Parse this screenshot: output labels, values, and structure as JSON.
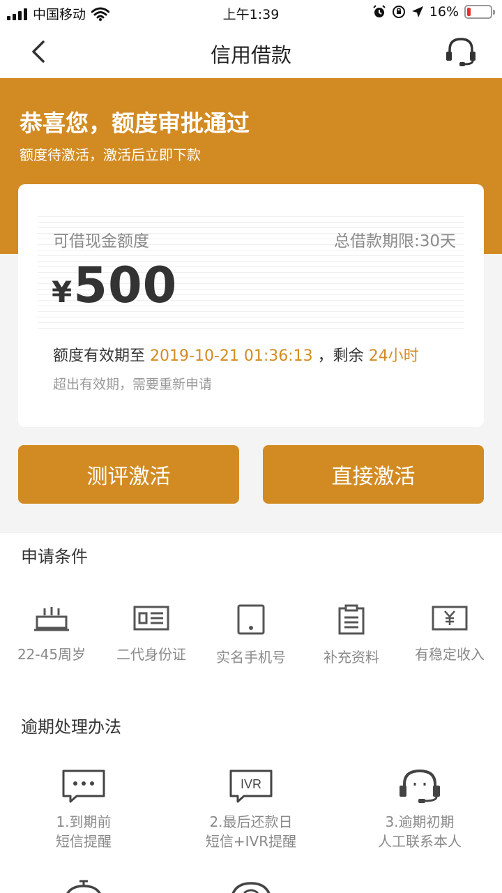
{
  "status_bar": {
    "carrier": "中国移动",
    "time": "上午1:39",
    "battery": "16%",
    "battery_level": 0.16
  },
  "nav": {
    "title": "信用借款",
    "back_icon": "chevron-left-icon",
    "service_icon": "headset-icon"
  },
  "hero": {
    "title": "恭喜您，额度审批通过",
    "subtitle": "额度待激活，激活后立即下款"
  },
  "card": {
    "label": "可借现金额度",
    "term": "总借款期限:30天",
    "currency": "¥",
    "amount": "500",
    "validity_prefix": "额度有效期至",
    "validity_date": "2019-10-21 01:36:13",
    "validity_mid": "，剩余",
    "validity_remaining": "24小时",
    "note": "超出有效期，需要重新申请"
  },
  "buttons": {
    "evaluate": "测评激活",
    "direct": "直接激活"
  },
  "conditions": {
    "title": "申请条件",
    "items": [
      {
        "label": "22-45周岁",
        "icon": "cake-icon"
      },
      {
        "label": "二代身份证",
        "icon": "id-card-icon"
      },
      {
        "label": "实名手机号",
        "icon": "phone-icon"
      },
      {
        "label": "补充资料",
        "icon": "clipboard-icon"
      },
      {
        "label": "有稳定收入",
        "icon": "money-icon"
      }
    ]
  },
  "overdue": {
    "title": "逾期处理办法",
    "items": [
      {
        "line1": "1.到期前",
        "line2": "短信提醒",
        "icon": "message-icon"
      },
      {
        "line1": "2.最后还款日",
        "line2": "短信+IVR提醒",
        "icon": "ivr-icon",
        "icon_text": "IVR"
      },
      {
        "line1": "3.逾期初期",
        "line2": "人工联系本人",
        "icon": "headset-icon"
      }
    ]
  },
  "colors": {
    "accent": "#d28b23",
    "background": "#f4f4f4",
    "muted": "#8a8a8a",
    "battery_low": "#e8302a"
  }
}
